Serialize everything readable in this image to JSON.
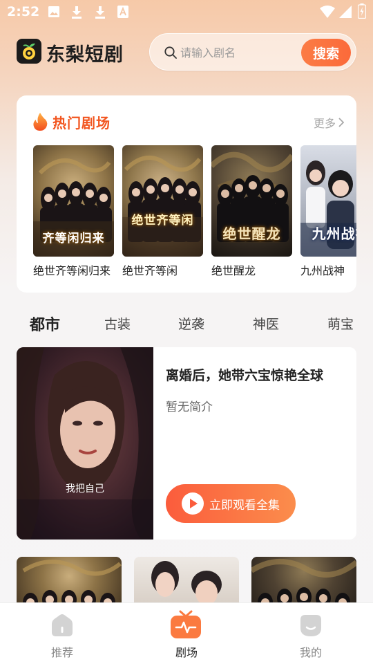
{
  "status_bar": {
    "time": "2:52",
    "icons": [
      "image-icon",
      "download-icon",
      "download-icon",
      "font-icon",
      "wifi-icon",
      "signal-icon",
      "battery-icon"
    ]
  },
  "header": {
    "app_name": "东梨短剧",
    "search": {
      "placeholder": "请输入剧名",
      "button_label": "搜索"
    }
  },
  "hot": {
    "title": "热门剧场",
    "more_label": "更多",
    "items": [
      {
        "title": "绝世齐等闲归来",
        "caption": "齐等闲归来"
      },
      {
        "title": "绝世齐等闲",
        "caption": "绝世齐等闲"
      },
      {
        "title": "绝世醒龙",
        "caption": "绝世醒龙"
      },
      {
        "title": "九州战神",
        "caption": "九州战神"
      }
    ]
  },
  "categories": [
    "都市",
    "古装",
    "逆袭",
    "神医",
    "萌宝"
  ],
  "active_category": "都市",
  "featured": {
    "title": "离婚后，她带六宝惊艳全球",
    "description": "暂无简介",
    "image_caption": "我把自己",
    "watch_label": "立即观看全集"
  },
  "bottom_nav": [
    {
      "label": "推荐",
      "icon": "home-icon",
      "active": false
    },
    {
      "label": "剧场",
      "icon": "theater-icon",
      "active": true
    },
    {
      "label": "我的",
      "icon": "profile-icon",
      "active": false
    }
  ],
  "colors": {
    "accent": "#fb6d3c",
    "hot_title": "#f2551f",
    "header_bg": "#f6c9a8"
  }
}
